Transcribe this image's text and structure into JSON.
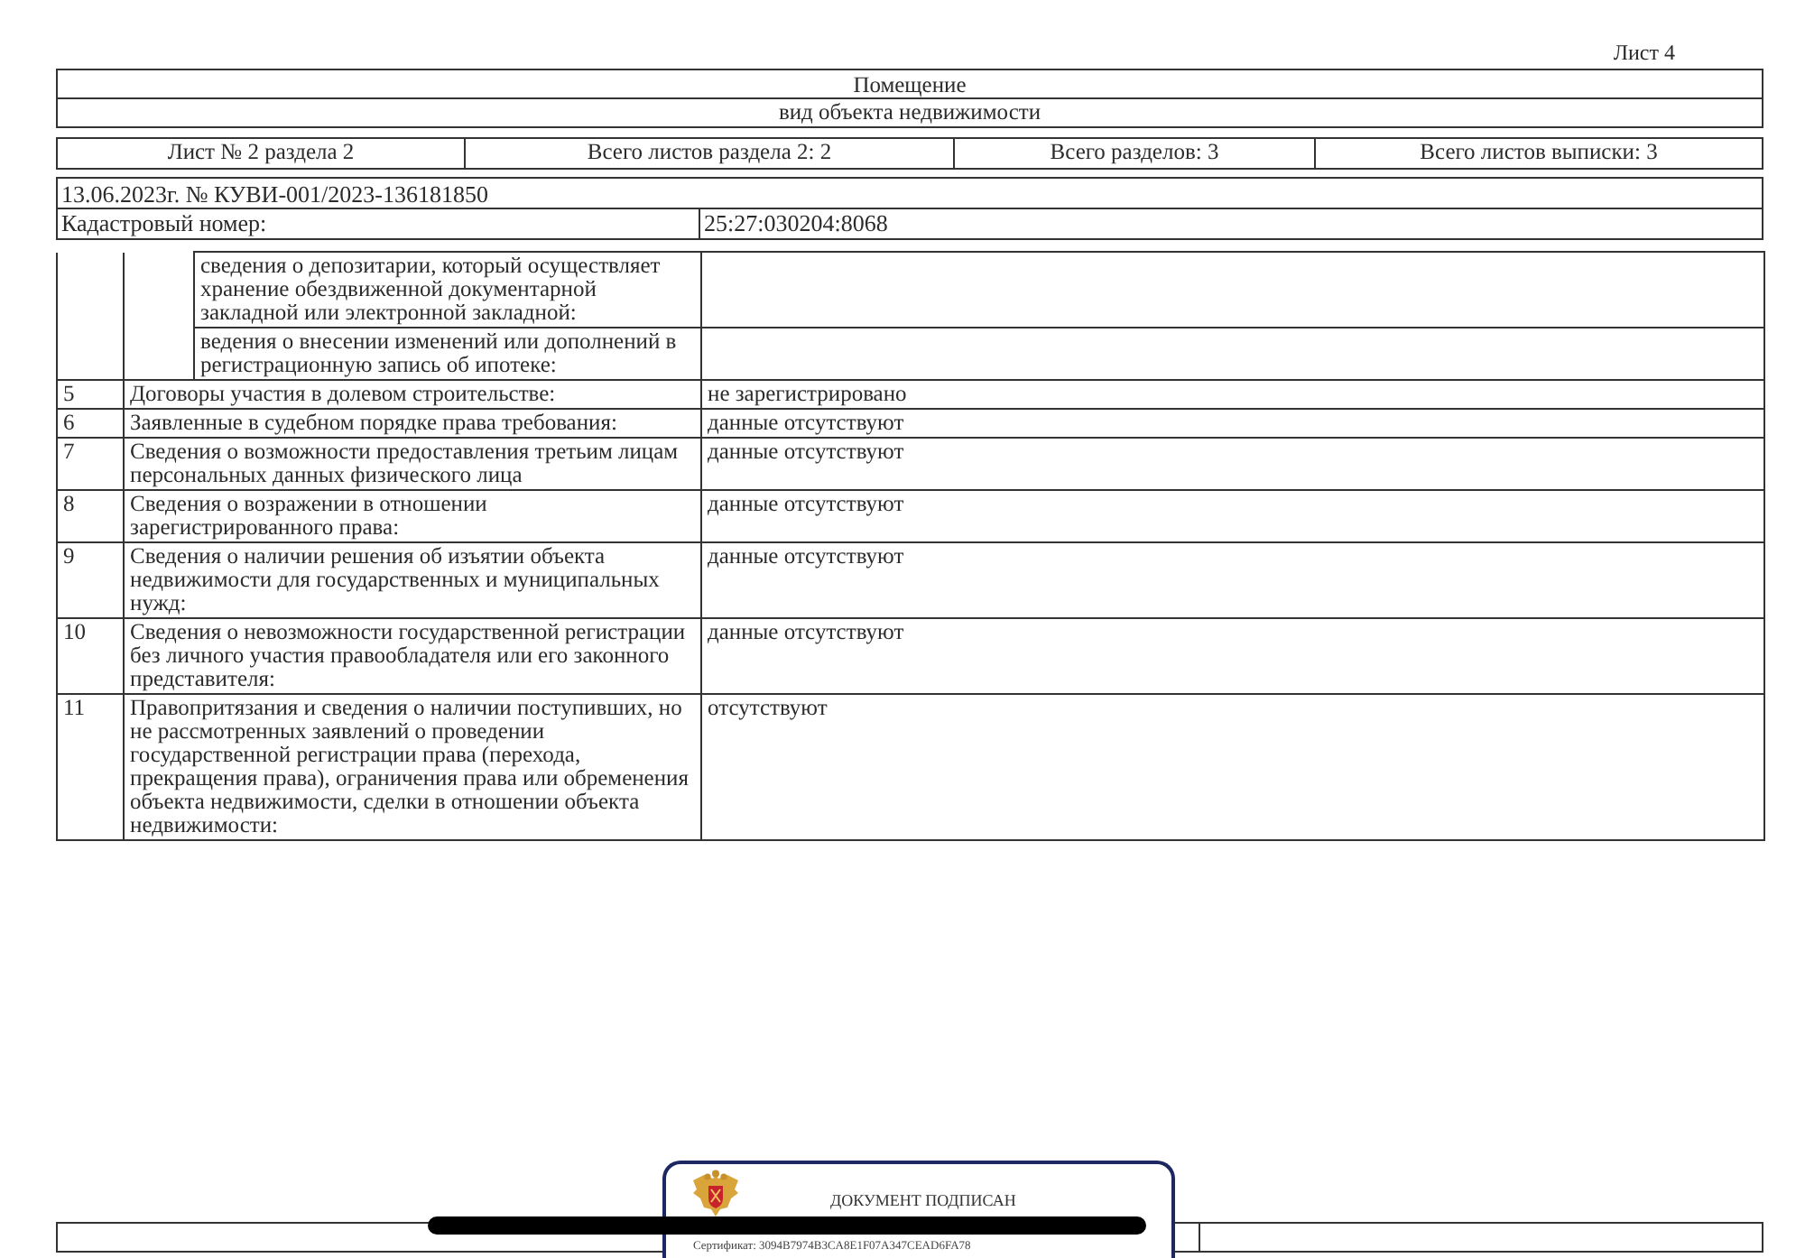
{
  "page_label": "Лист 4",
  "header": {
    "title": "Помещение",
    "subtitle": "вид объекта недвижимости"
  },
  "sheet_info": [
    "Лист № 2 раздела 2",
    "Всего листов раздела 2: 2",
    "Всего разделов: 3",
    "Всего листов выписки: 3"
  ],
  "extract": {
    "number": "13.06.2023г. № КУВИ-001/2023-136181850",
    "cadastral_label": "Кадастровый номер:",
    "cadastral_number": "25:27:030204:8068"
  },
  "continuation_rows": [
    {
      "label": "сведения о депозитарии, который осуществляет\nхранение обездвиженной документарной\nзакладной или электронной закладной:"
    },
    {
      "label": "ведения о внесении изменений или дополнений в\nрегистрационную запись об ипотеке:"
    }
  ],
  "rows": [
    {
      "number": "5",
      "label": "Договоры участия в долевом строительстве:",
      "value": "не зарегистрировано"
    },
    {
      "number": "6",
      "label": "Заявленные в судебном порядке права требования:",
      "value": "данные отсутствуют"
    },
    {
      "number": "7",
      "label": "Сведения о возможности предоставления третьим лицам\nперсональных данных физического лица",
      "value": "данные отсутствуют"
    },
    {
      "number": "8",
      "label": "Сведения о возражении в отношении\nзарегистрированного права:",
      "value": "данные отсутствуют"
    },
    {
      "number": "9",
      "label": "Сведения о наличии решения об изъятии объекта\nнедвижимости для государственных и муниципальных\nнужд:",
      "value": "данные отсутствуют"
    },
    {
      "number": "10",
      "label": "Сведения о невозможности государственной регистрации\nбез личного участия правообладателя или его законного\nпредставителя:",
      "value": "данные отсутствуют"
    },
    {
      "number": "11",
      "label": "Правопритязания и сведения о наличии поступивших, но\nне рассмотренных заявлений о проведении\nгосударственной регистрации права (перехода,\nпрекращения права), ограничения права или обременения\nобъекта недвижимости, сделки в отношении объекта\nнедвижимости:",
      "value": "отсутствуют"
    }
  ],
  "stamp": {
    "title": "ДОКУМЕНТ ПОДПИСАН",
    "certificate": "Сертификат: 3094B7974B3CA8E1F07A347CEAD6FA78"
  }
}
